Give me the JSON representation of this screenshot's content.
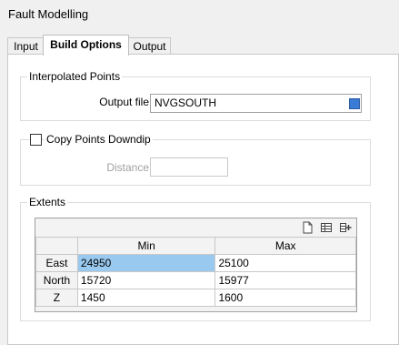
{
  "window": {
    "title": "Fault Modelling"
  },
  "tabs": [
    {
      "label": "Input",
      "active": false
    },
    {
      "label": "Build Options",
      "active": true
    },
    {
      "label": "Output",
      "active": false
    }
  ],
  "interpolated_points": {
    "group_title": "Interpolated Points",
    "output_file_label": "Output file",
    "output_file_value": "NVGSOUTH"
  },
  "copy_points": {
    "checkbox_label": "Copy Points Downdip",
    "checked": false,
    "distance_label": "Distance",
    "distance_value": ""
  },
  "extents": {
    "group_title": "Extents",
    "toolbar_icons": [
      "new-document-icon",
      "table-view-icon",
      "insert-row-icon"
    ],
    "columns": [
      "Min",
      "Max"
    ],
    "rows": [
      {
        "label": "East",
        "min": "24950",
        "max": "25100"
      },
      {
        "label": "North",
        "min": "15720",
        "max": "15977"
      },
      {
        "label": "Z",
        "min": "1450",
        "max": "1600"
      }
    ]
  },
  "colors": {
    "accent": "#3a7bd5",
    "selection": "#99c9ef"
  }
}
